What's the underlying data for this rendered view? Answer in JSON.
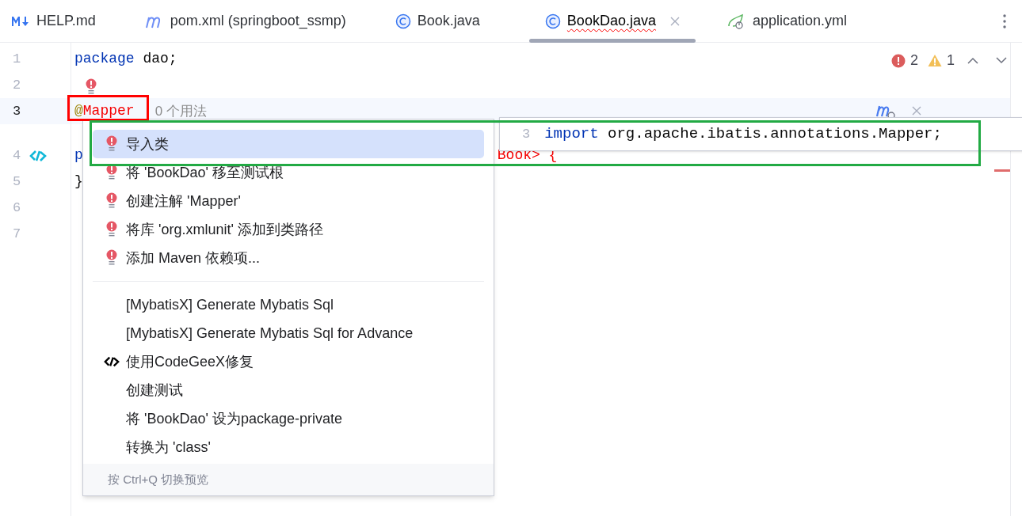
{
  "tabs": [
    {
      "label": "HELP.md",
      "kind": "markdown",
      "selected": false,
      "error": false
    },
    {
      "label": "pom.xml (springboot_ssmp)",
      "kind": "maven",
      "selected": false,
      "error": false
    },
    {
      "label": "Book.java",
      "kind": "class",
      "selected": false,
      "error": false
    },
    {
      "label": "BookDao.java",
      "kind": "class",
      "selected": true,
      "error": true
    },
    {
      "label": "application.yml",
      "kind": "spring",
      "selected": false,
      "error": false
    }
  ],
  "inspections": {
    "errors": "2",
    "warnings": "1"
  },
  "editor": {
    "lines": [
      {
        "number": "1",
        "current": false,
        "fragments": [
          {
            "text": "package",
            "kind": "keyword"
          },
          {
            "text": " dao;",
            "kind": "plain"
          }
        ]
      },
      {
        "number": "2",
        "current": false,
        "bulb": true
      },
      {
        "number": "3",
        "current": true,
        "fragments": [
          {
            "text": "@",
            "kind": "annotation"
          },
          {
            "text": "Mapper",
            "kind": "error"
          }
        ],
        "hint": "0 个用法"
      },
      {
        "number": "4",
        "current": false,
        "gutter_icon": true,
        "fragments": [
          {
            "text": "p",
            "kind": "keyword"
          },
          {
            "text": "Book> {",
            "kind": "error",
            "after_popup": true
          }
        ]
      },
      {
        "number": "5",
        "current": false,
        "fragments": [
          {
            "text": "}",
            "kind": "plain"
          }
        ]
      },
      {
        "number": "6",
        "current": false
      },
      {
        "number": "7",
        "current": false
      }
    ]
  },
  "intentions": {
    "groups": [
      [
        {
          "label": "导入类",
          "kind": "bulb",
          "selected": true
        },
        {
          "label": "将 'BookDao' 移至测试根",
          "kind": "bulb",
          "selected": false
        },
        {
          "label": "创建注解 'Mapper'",
          "kind": "bulb",
          "selected": false
        },
        {
          "label": "将库 'org.xmlunit' 添加到类路径",
          "kind": "bulb",
          "selected": false
        },
        {
          "label": "添加 Maven 依赖项...",
          "kind": "bulb",
          "selected": false
        }
      ],
      [
        {
          "label": "[MybatisX] Generate Mybatis Sql",
          "kind": "plain",
          "selected": false
        },
        {
          "label": "[MybatisX] Generate Mybatis Sql for Advance",
          "kind": "plain",
          "selected": false
        },
        {
          "label": "使用CodeGeeX修复",
          "kind": "codegeex",
          "selected": false
        },
        {
          "label": "创建测试",
          "kind": "plain",
          "selected": false
        },
        {
          "label": "将 'BookDao' 设为package-private",
          "kind": "plain",
          "selected": false
        },
        {
          "label": "转换为 'class'",
          "kind": "plain",
          "selected": false
        }
      ]
    ],
    "footer": "按 Ctrl+Q 切换预览"
  },
  "preview": {
    "line_number": "3",
    "fragments": [
      {
        "text": "import",
        "kind": "keyword"
      },
      {
        "text": " org.apache.ibatis.annotations.Mapper;",
        "kind": "plain"
      }
    ]
  },
  "highlights": [
    {
      "color": "#ff0000"
    },
    {
      "color": "#22aa44"
    }
  ]
}
